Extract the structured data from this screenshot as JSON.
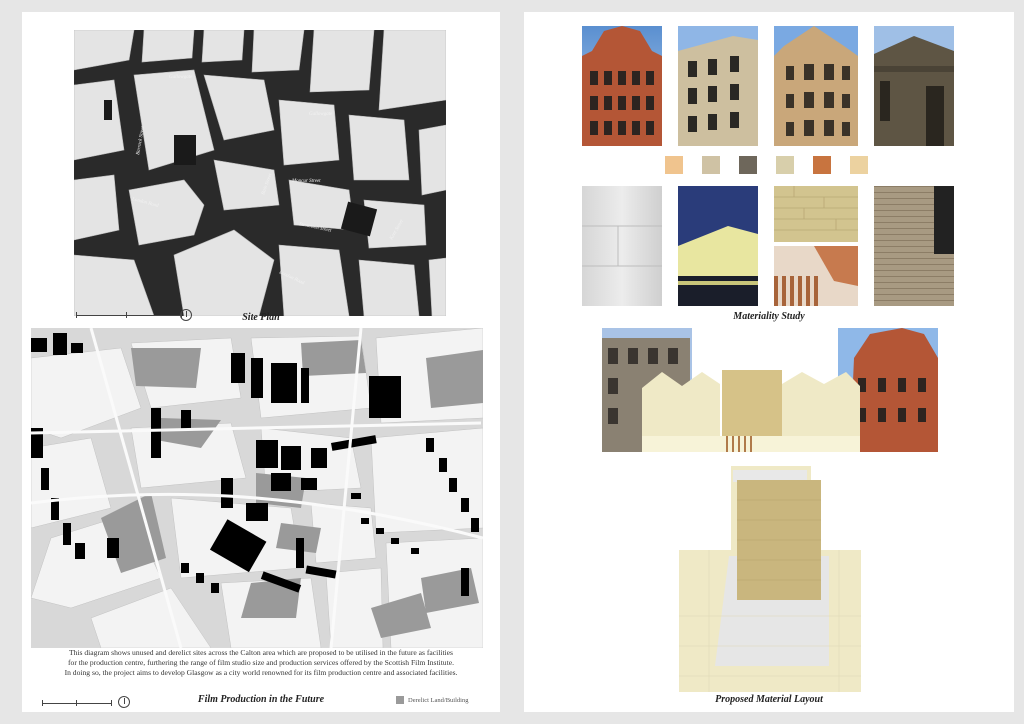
{
  "left_sheet": {
    "site_plan": {
      "caption": "Site Plan",
      "street_labels": [
        "Gallowgate",
        "Gallowgate",
        "London Road",
        "Moncur Street",
        "Kent Street",
        "London Road",
        "Bain Street",
        "Barrack Street",
        "Stevenson Street"
      ]
    },
    "future_map": {
      "caption": "Film Production in the Future",
      "description": [
        "This diagram shows unused and derelict sites across the Calton area which are proposed to be utilised in the future as facilities",
        "for the production centre, furthering the range of film studio size and production services offered by the Scottish Film Institute.",
        "In doing so, the project aims to develop Glasgow as a city world renowned for its film production centre and associated facilities."
      ],
      "legend_label": "Derelict Land/Building",
      "legend_color": "#9a9a9a"
    }
  },
  "right_sheet": {
    "materiality": {
      "caption": "Materiality Study",
      "swatch_colors": [
        "#f0c48e",
        "#cfc2a4",
        "#6e675b",
        "#d8cfab",
        "#c8743f",
        "#ecd2a0"
      ]
    },
    "layout": {
      "caption": "Proposed Material Layout"
    }
  }
}
